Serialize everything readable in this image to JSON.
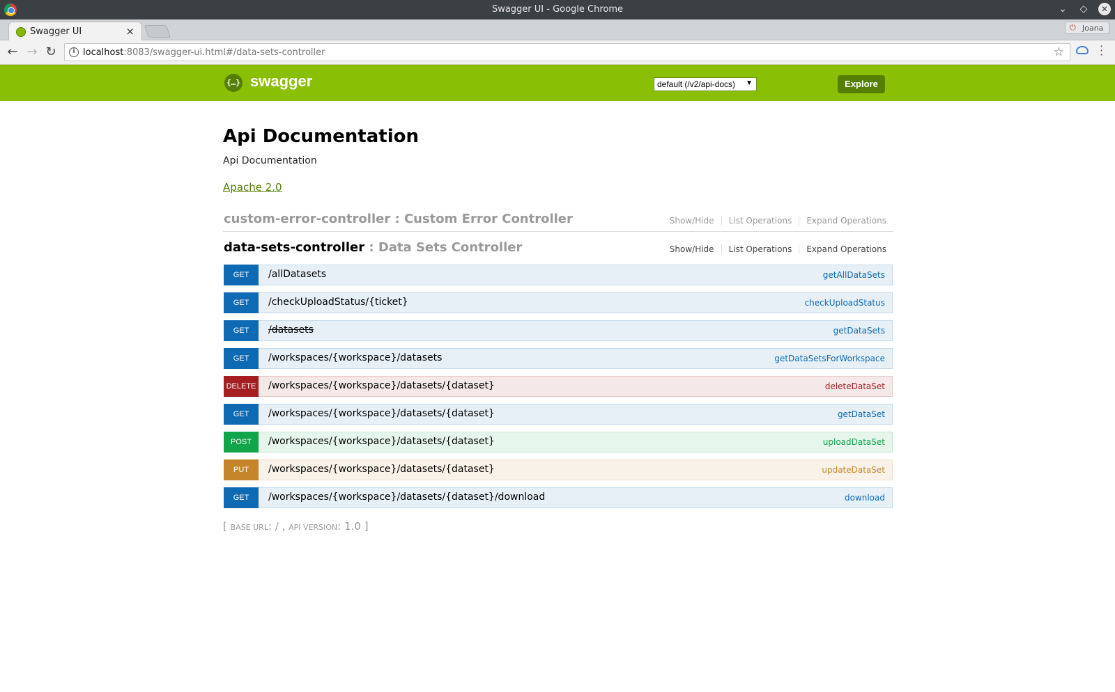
{
  "window": {
    "title": "Swagger UI - Google Chrome"
  },
  "tab": {
    "label": "Swagger UI",
    "close": "×"
  },
  "profile": {
    "name": "Joana"
  },
  "omnibox": {
    "host": "localhost",
    "rest": ":8083/swagger-ui.html#/data-sets-controller"
  },
  "header": {
    "brand": "swagger",
    "api_select": "default (/v2/api-docs)",
    "explore_label": "Explore"
  },
  "info": {
    "title": "Api Documentation",
    "description": "Api Documentation",
    "license": "Apache 2.0"
  },
  "resources": [
    {
      "name": "custom-error-controller",
      "sep": " : ",
      "description": "Custom Error Controller"
    },
    {
      "name": "data-sets-controller",
      "sep": " : ",
      "description": "Data Sets Controller"
    }
  ],
  "resource_ops": {
    "show_hide": "Show/Hide",
    "list": "List Operations",
    "expand": "Expand Operations"
  },
  "operations": [
    {
      "method": "GET",
      "path": "/allDatasets",
      "nickname": "getAllDataSets"
    },
    {
      "method": "GET",
      "path": "/checkUploadStatus/{ticket}",
      "nickname": "checkUploadStatus"
    },
    {
      "method": "GET",
      "path": "/datasets",
      "nickname": "getDataSets"
    },
    {
      "method": "GET",
      "path": "/workspaces/{workspace}/datasets",
      "nickname": "getDataSetsForWorkspace"
    },
    {
      "method": "DELETE",
      "path": "/workspaces/{workspace}/datasets/{dataset}",
      "nickname": "deleteDataSet"
    },
    {
      "method": "GET",
      "path": "/workspaces/{workspace}/datasets/{dataset}",
      "nickname": "getDataSet"
    },
    {
      "method": "POST",
      "path": "/workspaces/{workspace}/datasets/{dataset}",
      "nickname": "uploadDataSet"
    },
    {
      "method": "PUT",
      "path": "/workspaces/{workspace}/datasets/{dataset}",
      "nickname": "updateDataSet"
    },
    {
      "method": "GET",
      "path": "/workspaces/{workspace}/datasets/{dataset}/download",
      "nickname": "download"
    }
  ],
  "footer": {
    "open": "[ ",
    "base_url_label": "base url",
    "base_url": ": / , ",
    "api_version_label": "api version",
    "api_version": ": 1.0 ]"
  },
  "colors": {
    "header_green": "#89bf04",
    "get": "#0f6ab4",
    "delete": "#a41e22",
    "post": "#10a54a",
    "put": "#c5862b"
  },
  "icons": {
    "back": "arrow-left-icon",
    "forward": "arrow-right-icon",
    "reload": "reload-icon",
    "info": "info-icon",
    "bookmark": "star-icon",
    "extension": "cloud-icon",
    "menu": "kebab-menu-icon"
  }
}
